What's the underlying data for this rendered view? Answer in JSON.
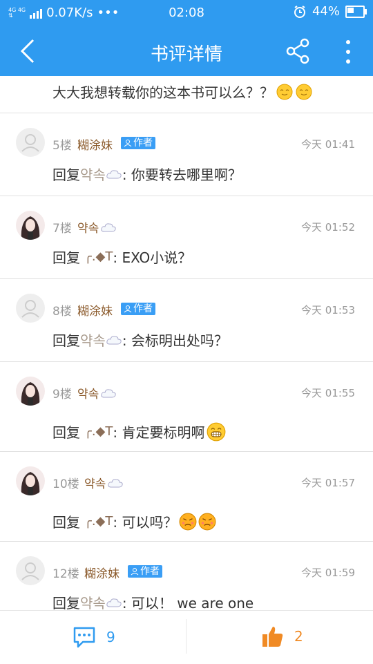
{
  "status_bar": {
    "network": "4G 4G",
    "speed": "0.07K/s",
    "dots": "•••",
    "time": "02:08",
    "battery": "44%",
    "battery_level": 0.44
  },
  "nav": {
    "title": "书评详情"
  },
  "first_comment": {
    "text": "大大我想转载你的这本书可以么？？"
  },
  "comments": [
    {
      "floor": "5楼",
      "name": "糊涂妹",
      "author_badge": "作者",
      "time": "今天 01:41",
      "prefix": "回复",
      "target": "약속",
      "text": ": 你要转去哪里啊？",
      "avatar": "default"
    },
    {
      "floor": "7楼",
      "name": "약속",
      "author_badge": "",
      "time": "今天 01:52",
      "prefix": "回复",
      "target": "╭.◆T",
      "text": ": EXO小说？",
      "avatar": "girl"
    },
    {
      "floor": "8楼",
      "name": "糊涂妹",
      "author_badge": "作者",
      "time": "今天 01:53",
      "prefix": "回复",
      "target": "약속",
      "text": ": 会标明出处吗？",
      "avatar": "default"
    },
    {
      "floor": "9楼",
      "name": "약속",
      "author_badge": "",
      "time": "今天 01:55",
      "prefix": "回复",
      "target": "╭.◆T",
      "text": ": 肯定要标明啊",
      "avatar": "girl"
    },
    {
      "floor": "10楼",
      "name": "약속",
      "author_badge": "",
      "time": "今天 01:57",
      "prefix": "回复",
      "target": "╭.◆T",
      "text": ": 可以吗？",
      "avatar": "girl"
    },
    {
      "floor": "12楼",
      "name": "糊涂妹",
      "author_badge": "作者",
      "time": "今天 01:59",
      "prefix": "回复",
      "target": "약속",
      "text": ": 可以！ we are one",
      "avatar": "default"
    }
  ],
  "bottom_bar": {
    "comment_count": "9",
    "like_count": "2"
  },
  "colors": {
    "primary": "#2f9bf0",
    "name": "#8b5a2b",
    "badge": "#3a9ef5",
    "like": "#f08a24"
  }
}
